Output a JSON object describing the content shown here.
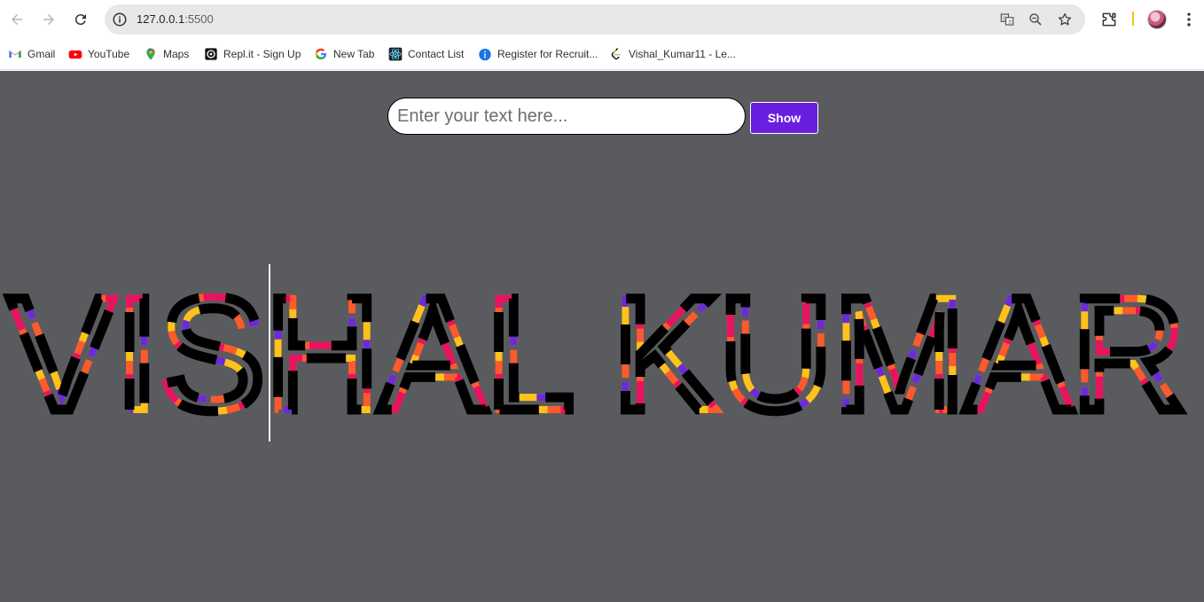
{
  "browser": {
    "url_host": "127.0.0.1",
    "url_port": ":5500"
  },
  "bookmarks": [
    {
      "label": "Gmail",
      "icon": "gmail-icon"
    },
    {
      "label": "YouTube",
      "icon": "youtube-icon"
    },
    {
      "label": "Maps",
      "icon": "maps-icon"
    },
    {
      "label": "Repl.it - Sign Up",
      "icon": "replit-icon"
    },
    {
      "label": "New Tab",
      "icon": "google-icon"
    },
    {
      "label": "Contact List",
      "icon": "react-icon"
    },
    {
      "label": "Register for Recruit...",
      "icon": "info-circle-icon"
    },
    {
      "label": "Vishal_Kumar11 - Le...",
      "icon": "leetcode-icon"
    }
  ],
  "app": {
    "input_placeholder": "Enter your text here...",
    "input_value": "",
    "button_label": "Show",
    "display_text": "VISHAL KUMAR",
    "display_colors": [
      "#ffc21a",
      "#ff5a2c",
      "#e8135e",
      "#6a2bd6"
    ],
    "button_color": "#6a1ee0",
    "background_color": "#5a5b5e"
  }
}
